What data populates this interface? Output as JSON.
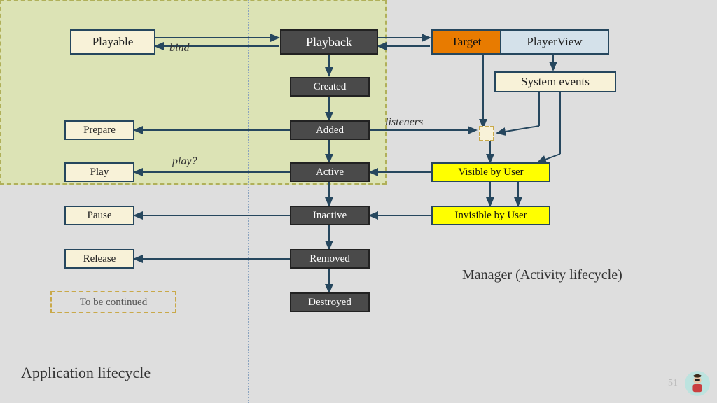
{
  "title": "Application lifecycle",
  "page_number": "51",
  "labels": {
    "bind": "bind",
    "play_q": "play?",
    "listeners": "listeners"
  },
  "boxes": {
    "playable": "Playable",
    "playback": "Playback",
    "target": "Target",
    "playerview": "PlayerView",
    "system_events": "System events",
    "created": "Created",
    "added": "Added",
    "active": "Active",
    "inactive": "Inactive",
    "removed": "Removed",
    "destroyed": "Destroyed",
    "prepare": "Prepare",
    "play": "Play",
    "pause": "Pause",
    "release": "Release",
    "tbc": "To be continued",
    "visible": "Visible by User",
    "invisible": "Invisible by User",
    "manager": "Manager (Activity lifecycle)"
  }
}
